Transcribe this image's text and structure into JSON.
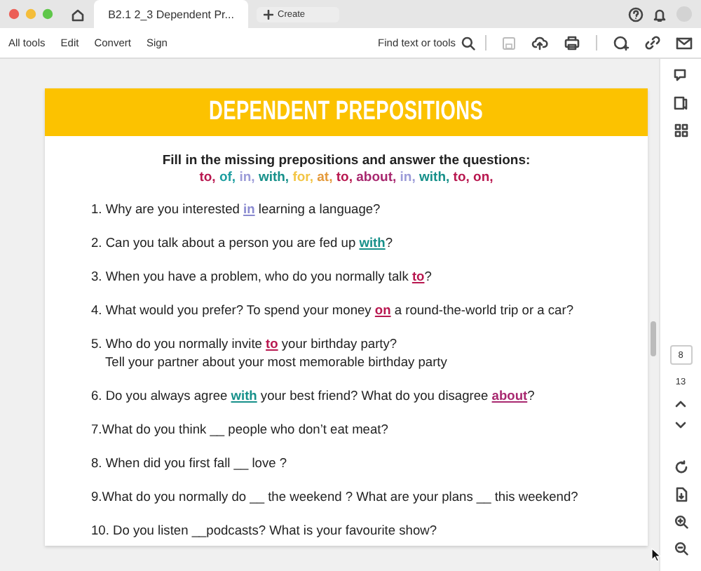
{
  "window": {
    "tab_title": "B2.1 2_3 Dependent Pr...",
    "new_tab": "Create"
  },
  "toolbar": {
    "menu": [
      "All tools",
      "Edit",
      "Convert",
      "Sign"
    ],
    "search": "Find text or tools"
  },
  "worksheet": {
    "title": "DEPENDENT PREPOSITIONS",
    "instruction": "Fill in the missing prepositions and answer the questions:",
    "word_bank": [
      {
        "text": "to,",
        "color": "#b8174f"
      },
      {
        "text": "of,",
        "color": "#1b9ea0"
      },
      {
        "text": "in,",
        "color": "#9b9bd8"
      },
      {
        "text": "with,",
        "color": "#16908a"
      },
      {
        "text": "for,",
        "color": "#f3c544"
      },
      {
        "text": "at,",
        "color": "#e49a3b"
      },
      {
        "text": "to,",
        "color": "#b8174f"
      },
      {
        "text": "about,",
        "color": "#a8286f"
      },
      {
        "text": "in,",
        "color": "#9b9bd8"
      },
      {
        "text": "with,",
        "color": "#16908a"
      },
      {
        "text": "to,",
        "color": "#b8174f"
      },
      {
        "text": "on,",
        "color": "#b8174f"
      }
    ],
    "questions": [
      {
        "lines": [
          [
            {
              "kind": "plain",
              "text": "1. Why are you interested "
            },
            {
              "kind": "answer",
              "text": "in",
              "color": "#8a8ad0"
            },
            {
              "kind": "plain",
              "text": " learning a language?"
            }
          ]
        ]
      },
      {
        "lines": [
          [
            {
              "kind": "plain",
              "text": "2. Can you talk about a person you are fed up "
            },
            {
              "kind": "answer",
              "text": "with",
              "color": "#16908a"
            },
            {
              "kind": "plain",
              "text": "?"
            }
          ]
        ]
      },
      {
        "lines": [
          [
            {
              "kind": "plain",
              "text": "3. When you have a problem, who do you normally talk "
            },
            {
              "kind": "answer",
              "text": "to",
              "color": "#b8174f"
            },
            {
              "kind": "plain",
              "text": "?"
            }
          ]
        ]
      },
      {
        "lines": [
          [
            {
              "kind": "plain",
              "text": "4. What would you prefer? To spend your money "
            },
            {
              "kind": "answer",
              "text": "on",
              "color": "#b8174f"
            },
            {
              "kind": "plain",
              "text": " a round-the-world trip or a car?"
            }
          ]
        ]
      },
      {
        "lines": [
          [
            {
              "kind": "plain",
              "text": "5. Who do you normally invite "
            },
            {
              "kind": "answer",
              "text": "to",
              "color": "#b8174f"
            },
            {
              "kind": "plain",
              "text": " your birthday party?"
            }
          ],
          [
            {
              "kind": "plain",
              "text": "Tell your partner about your most memorable birthday party"
            }
          ]
        ]
      },
      {
        "lines": [
          [
            {
              "kind": "plain",
              "text": "6. Do you always agree "
            },
            {
              "kind": "answer",
              "text": "with",
              "color": "#16908a"
            },
            {
              "kind": "plain",
              "text": " your best friend? What do you disagree "
            },
            {
              "kind": "answer",
              "text": "about",
              "color": "#a8286f"
            },
            {
              "kind": "plain",
              "text": "?"
            }
          ]
        ]
      },
      {
        "lines": [
          [
            {
              "kind": "plain",
              "text": "7.What do you think __ people who don’t eat meat?"
            }
          ]
        ]
      },
      {
        "lines": [
          [
            {
              "kind": "plain",
              "text": "8. When did you first fall __ love ?"
            }
          ]
        ]
      },
      {
        "lines": [
          [
            {
              "kind": "plain",
              "text": "9.What do you normally do __ the weekend ? What are your plans __ this weekend?"
            }
          ]
        ]
      },
      {
        "lines": [
          [
            {
              "kind": "plain",
              "text": "10. Do you listen __podcasts? What is your favourite show?"
            }
          ]
        ]
      }
    ]
  },
  "rail": {
    "page_input": "8",
    "page_total": "13"
  }
}
